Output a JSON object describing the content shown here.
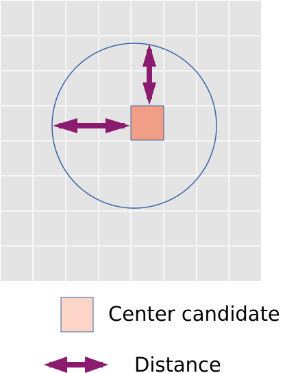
{
  "colors": {
    "grid_background": "#e4e4e4",
    "grid_line": "#f7f7f7",
    "circle_stroke": "#3a63a8",
    "center_cell_fill": "#f19e87",
    "center_cell_stroke": "#3a5fa0",
    "legend_swatch_fill": "#fdd4c8",
    "arrow": "#8b1b6e"
  },
  "legend": {
    "center_label": "Center candidate",
    "distance_label": "Distance"
  },
  "icons": {
    "arrow": "double-headed-arrow"
  }
}
